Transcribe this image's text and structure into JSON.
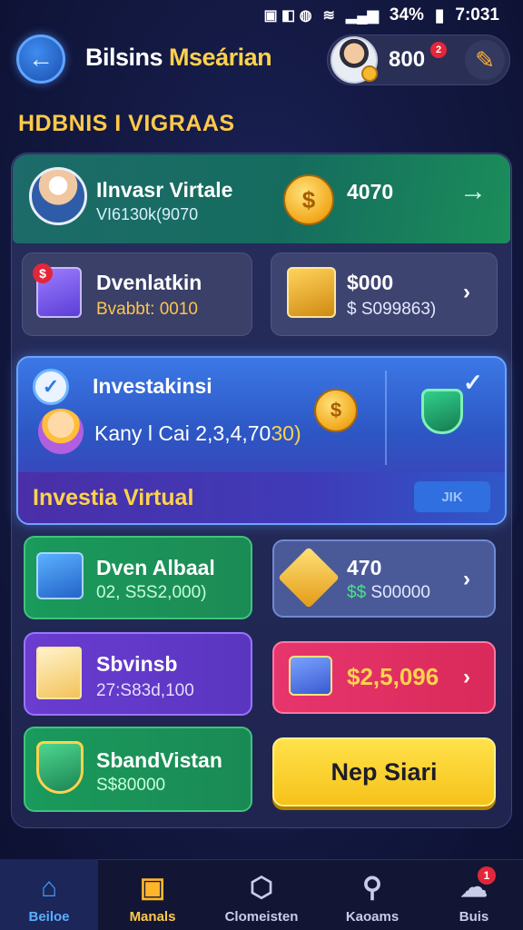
{
  "status_bar": {
    "battery": "34%",
    "time": "7:031"
  },
  "header": {
    "title_part1": "Bilsins",
    "title_part2": "Mseárian",
    "coin_count": "800",
    "notification_count": "2"
  },
  "section_heading": "HDBNIS I VIGRAAS",
  "banner": {
    "name": "Ilnvasr Virtale",
    "subtitle": "VI6130k(9070",
    "value": "4070"
  },
  "cards": {
    "card_a": {
      "title": "Dvenlatkin",
      "subtitle": "Bvabbt: 0010"
    },
    "card_b": {
      "title": "$000",
      "subtitle": "$ S099863)"
    },
    "card_c": {
      "title": "Dven Albaal",
      "subtitle": "02, S5S2,000)"
    },
    "card_d": {
      "title": "470",
      "subtitle_prefix": "$$",
      "subtitle": "S00000"
    },
    "card_e": {
      "title": "Sbvinsb",
      "subtitle": "27:S83d,100"
    },
    "card_f": {
      "title": "$2,5,096"
    },
    "card_g": {
      "title": "SbandVistan",
      "subtitle": "S$80000"
    }
  },
  "invest_card": {
    "title": "Investakinsi",
    "stat_label": "Kany l Cai",
    "stat_value": "2,3,4,70",
    "stat_highlight": "30)",
    "footer_label": "Investia Virtual",
    "footer_button": "JIK"
  },
  "cta_button": "Nep Siari",
  "bottom_nav": [
    {
      "label": "Beiloe",
      "icon": "home-icon"
    },
    {
      "label": "Manals",
      "icon": "missions-icon"
    },
    {
      "label": "Clomeisten",
      "icon": "cube-icon"
    },
    {
      "label": "Kaoams",
      "icon": "search-icon"
    },
    {
      "label": "Buis",
      "icon": "chat-icon",
      "badge": "1"
    }
  ],
  "colors": {
    "accent_gold": "#ffd24d",
    "primary_blue": "#3b78e6",
    "success_green": "#1a9a5c",
    "danger_pink": "#e7356d",
    "background": "#141a44"
  }
}
